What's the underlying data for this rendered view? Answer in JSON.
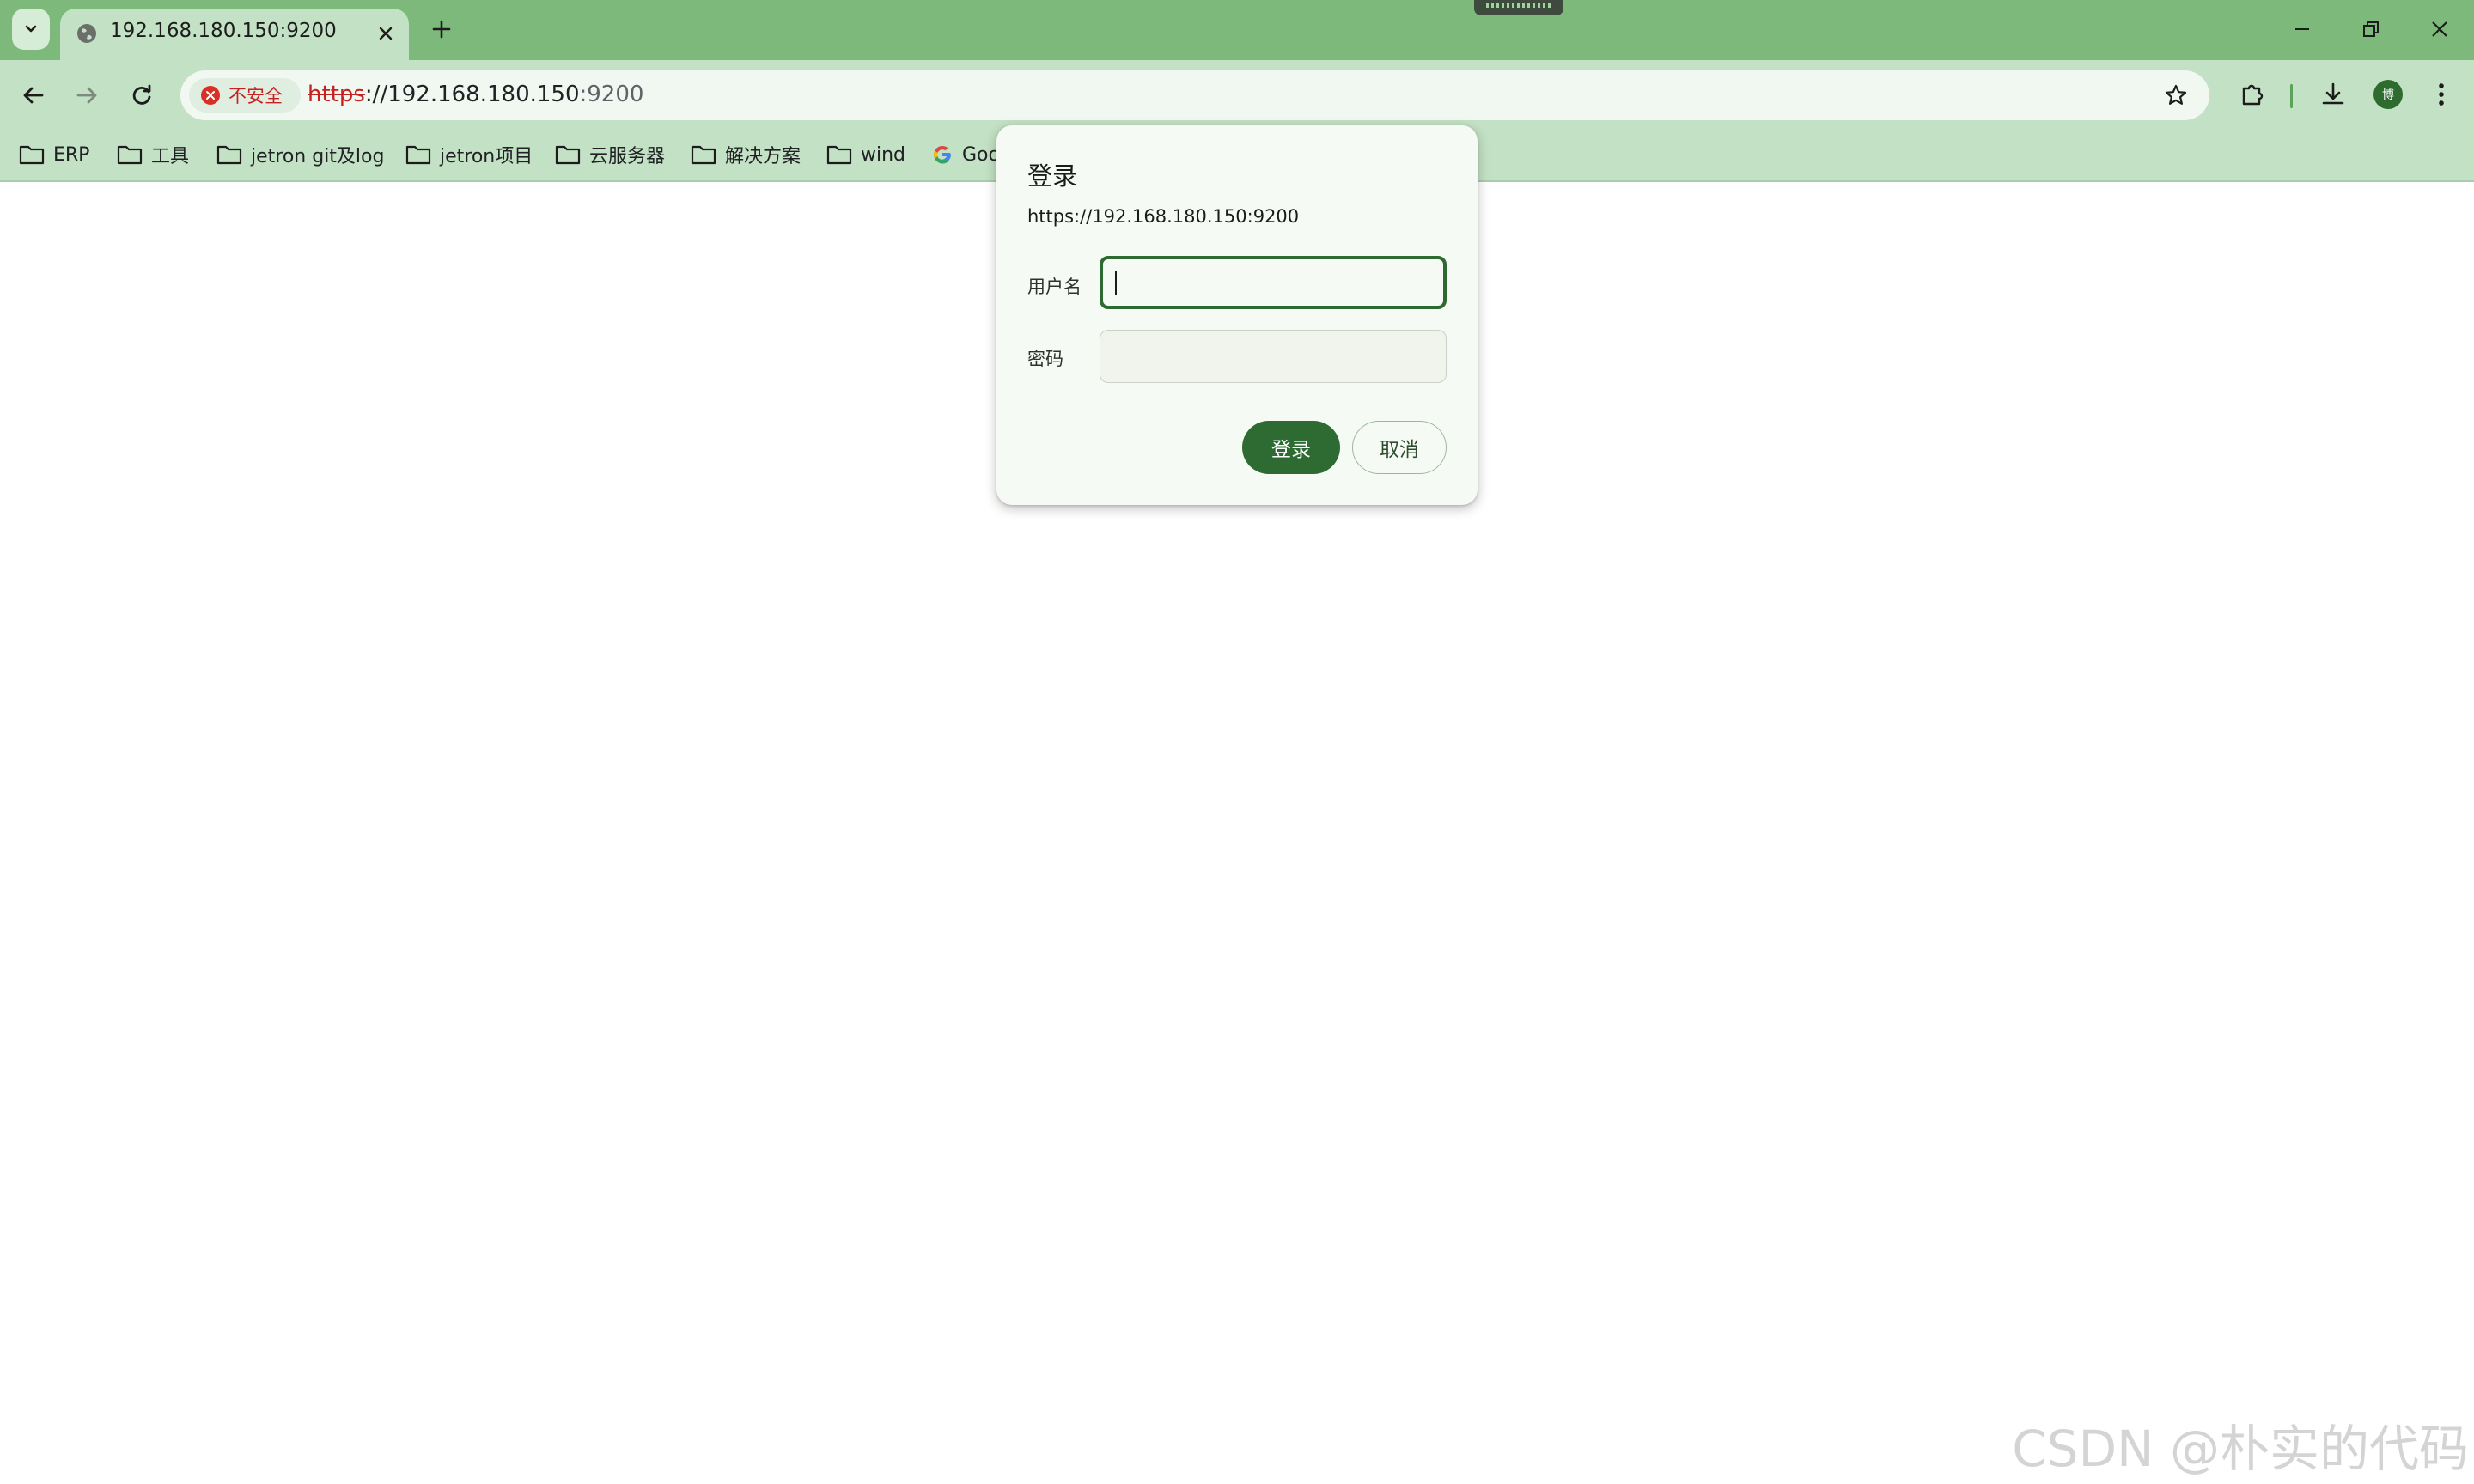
{
  "tab": {
    "title": "192.168.180.150:9200"
  },
  "omnibox": {
    "security_label": "不安全",
    "url_scheme": "https",
    "url_host": "://192.168.180.150",
    "url_port": ":9200"
  },
  "profile": {
    "initial": "博"
  },
  "bookmarks": [
    {
      "label": "ERP",
      "icon": "folder-icon"
    },
    {
      "label": "工具",
      "icon": "folder-icon"
    },
    {
      "label": "jetron git及log",
      "icon": "folder-icon"
    },
    {
      "label": "jetron项目",
      "icon": "folder-icon"
    },
    {
      "label": "云服务器",
      "icon": "folder-icon"
    },
    {
      "label": "解决方案",
      "icon": "folder-icon"
    },
    {
      "label": "wind",
      "icon": "folder-icon"
    },
    {
      "label": "Goo",
      "icon": "google-icon"
    }
  ],
  "dialog": {
    "title": "登录",
    "url": "https://192.168.180.150:9200",
    "username_label": "用户名",
    "username_value": "",
    "password_label": "密码",
    "password_value": "",
    "login_button": "登录",
    "cancel_button": "取消"
  },
  "watermark": "CSDN @朴实的代码",
  "colors": {
    "tabstrip": "#7cb97b",
    "toolbar": "#c3e1c4",
    "accent": "#2e6b33",
    "insecure": "#c5221f"
  }
}
